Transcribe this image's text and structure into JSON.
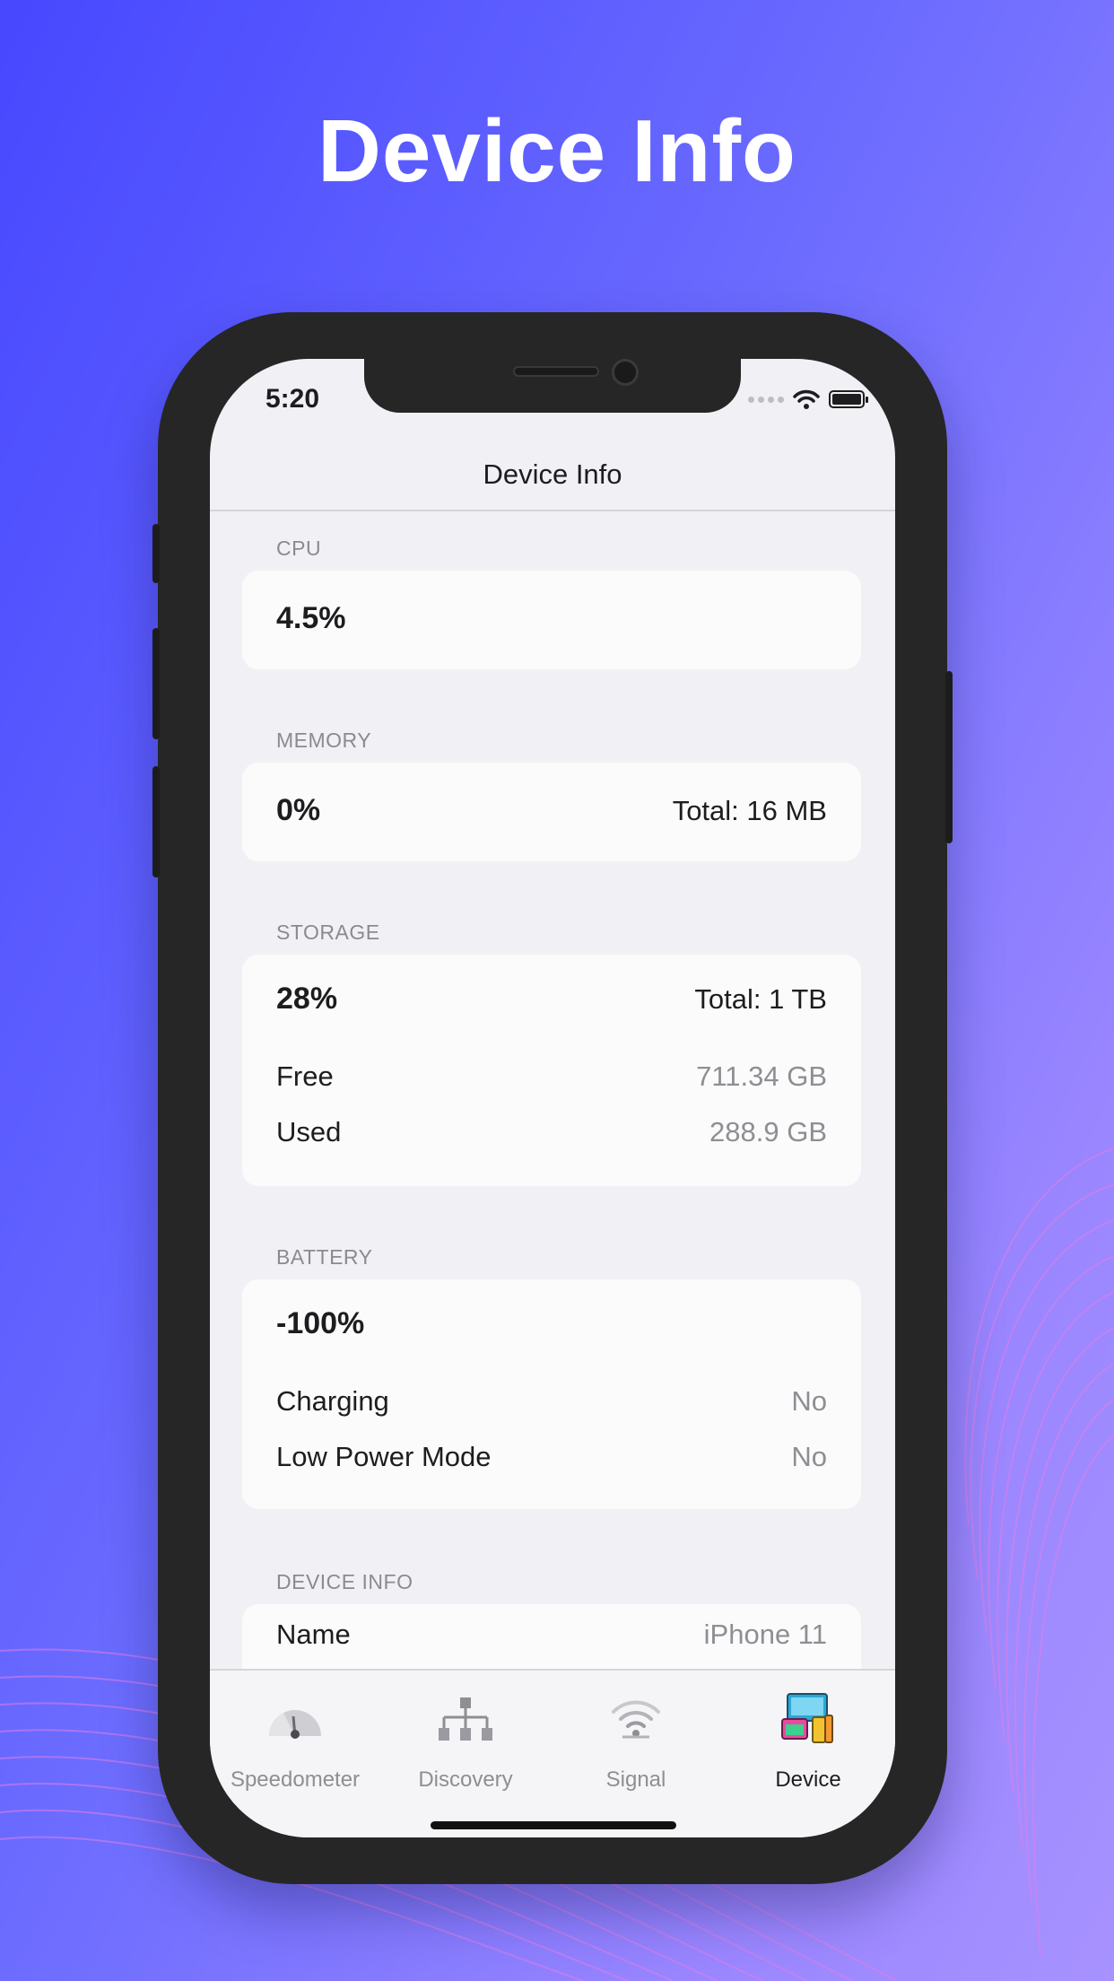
{
  "hero": {
    "title": "Device Info"
  },
  "status_bar": {
    "time": "5:20"
  },
  "navbar": {
    "title": "Device Info"
  },
  "sections": {
    "cpu": {
      "label": "CPU",
      "percent": "4.5%"
    },
    "memory": {
      "label": "MEMORY",
      "percent": "0%",
      "total": "Total: 16 MB"
    },
    "storage": {
      "label": "STORAGE",
      "percent": "28%",
      "total": "Total: 1 TB",
      "rows": [
        {
          "label": "Free",
          "value": "711.34 GB"
        },
        {
          "label": "Used",
          "value": "288.9 GB"
        }
      ]
    },
    "battery": {
      "label": "BATTERY",
      "percent": "-100%",
      "rows": [
        {
          "label": "Charging",
          "value": "No"
        },
        {
          "label": "Low Power Mode",
          "value": "No"
        }
      ]
    },
    "device_info": {
      "label": "DEVICE INFO",
      "rows": [
        {
          "label": "Name",
          "value": "iPhone 11"
        }
      ]
    }
  },
  "tabbar": {
    "active_tab": "Device",
    "items": [
      {
        "label": "Speedometer",
        "icon": "speedometer-icon"
      },
      {
        "label": "Discovery",
        "icon": "network-tree-icon"
      },
      {
        "label": "Signal",
        "icon": "wifi-signal-icon"
      },
      {
        "label": "Device",
        "icon": "device-icon"
      }
    ]
  },
  "colors": {
    "background_start": "#4748ff",
    "background_end": "#a792ff",
    "phone_frame": "#262626",
    "screen_bg": "#f1f1f5"
  }
}
